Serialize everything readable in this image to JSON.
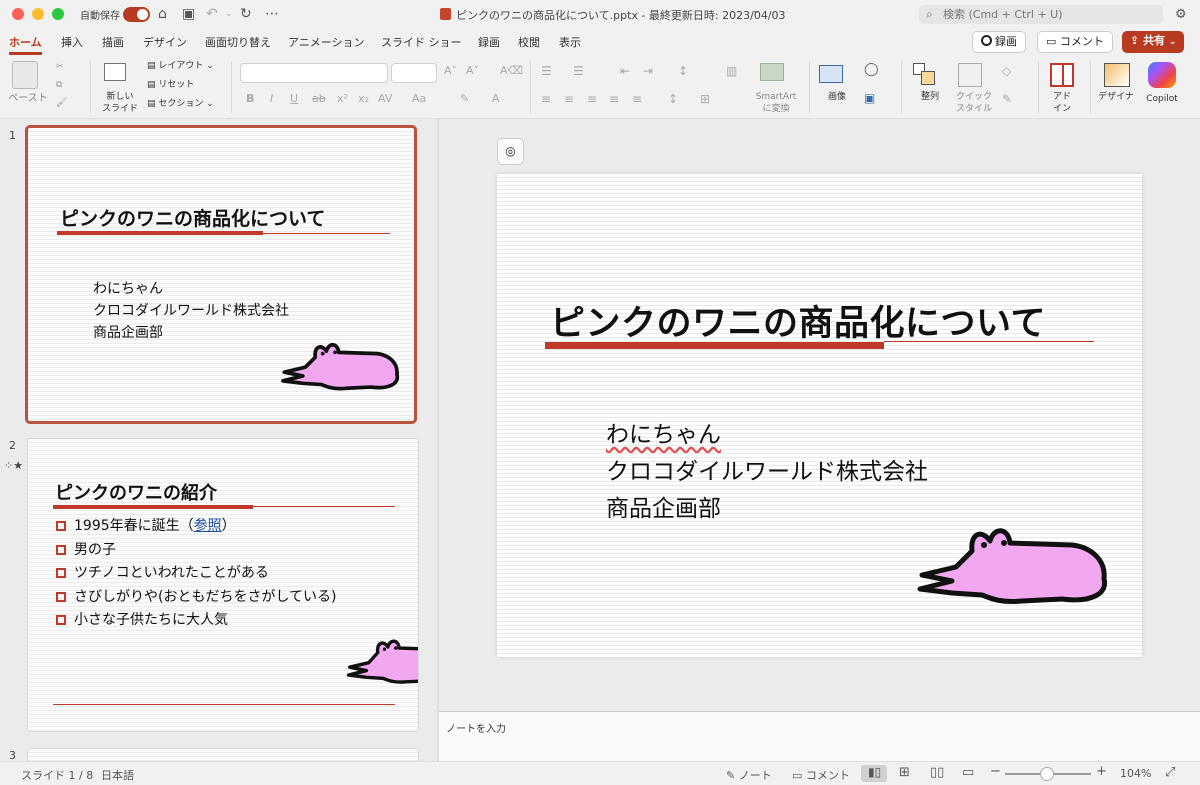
{
  "titlebar": {
    "autosave_label": "自動保存",
    "doc_title": "ピンクのワニの商品化について.pptx - 最終更新日時: 2023/04/03",
    "search_placeholder": "検索 (Cmd + Ctrl + U)"
  },
  "tabs": [
    "ホーム",
    "挿入",
    "描画",
    "デザイン",
    "画面切り替え",
    "アニメーション",
    "スライド ショー",
    "録画",
    "校閲",
    "表示"
  ],
  "active_tab": "ホーム",
  "actions": {
    "record": "録画",
    "comment": "コメント",
    "share": "共有"
  },
  "ribbon": {
    "paste": "ペースト",
    "new_slide": "新しい\nスライド",
    "layout": "レイアウト",
    "reset": "リセット",
    "section": "セクション",
    "smartart": "SmartArt\nに変換",
    "image": "画像",
    "arrange": "整列",
    "quick_style": "クイック\nスタイル",
    "addin": "アド\nイン",
    "designer": "デザイナ",
    "copilot": "Copilot"
  },
  "slides": [
    {
      "num": "1",
      "title": "ピンクのワニの商品化について",
      "lines": [
        "わにちゃん",
        "クロコダイルワールド株式会社",
        "商品企画部"
      ]
    },
    {
      "num": "2",
      "title": "ピンクのワニの紹介",
      "bullets": [
        "1995年春に誕生（",
        "男の子",
        "ツチノコといわれたことがある",
        "さびしがりや(おともだちをさがしている)",
        "小さな子供たちに大人気"
      ],
      "bullet1_link": "参照",
      "bullet1_end": "）"
    },
    {
      "num": "3"
    }
  ],
  "notes_placeholder": "ノートを入力",
  "status": {
    "slide_info": "スライド 1 / 8",
    "language": "日本語",
    "notes": "ノート",
    "comments": "コメント",
    "zoom": "104%"
  },
  "colors": {
    "accent": "#b83a20",
    "rule": "#c0392b",
    "croc": "#f2a8f0"
  }
}
